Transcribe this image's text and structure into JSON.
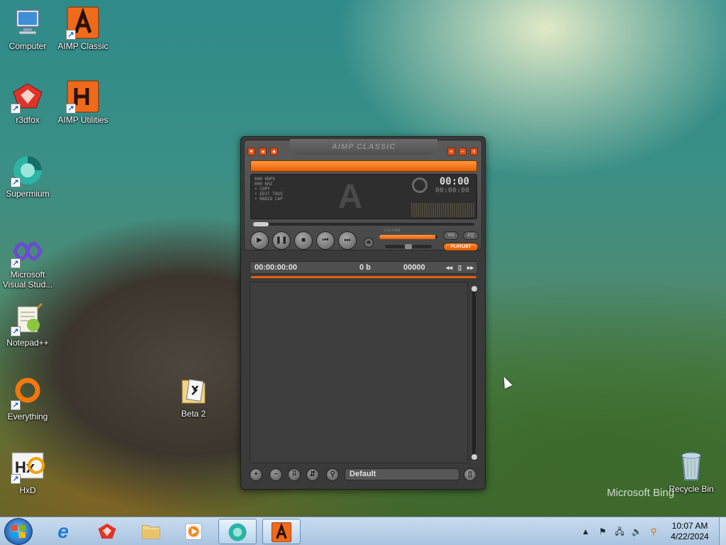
{
  "desktop": {
    "icons": [
      {
        "label": "Computer",
        "glyph": "computer-icon"
      },
      {
        "label": "AIMP Classic",
        "glyph": "aimp-icon"
      },
      {
        "label": "r3dfox",
        "glyph": "r3dfox-icon"
      },
      {
        "label": "AIMP Utilities",
        "glyph": "aimp-utilities-icon"
      },
      {
        "label": "Supermium",
        "glyph": "supermium-icon"
      },
      {
        "label": "Microsoft Visual Stud...",
        "glyph": "visual-studio-icon"
      },
      {
        "label": "Notepad++",
        "glyph": "notepadpp-icon"
      },
      {
        "label": "Everything",
        "glyph": "everything-icon"
      },
      {
        "label": "HxD",
        "glyph": "hxd-icon"
      },
      {
        "label": "Beta 2",
        "glyph": "folder-icon"
      },
      {
        "label": "Recycle Bin",
        "glyph": "recycle-bin-icon"
      }
    ],
    "watermark": "Microsoft Bing"
  },
  "player": {
    "title": "AIMP CLASSIC",
    "info_lines": [
      "000 KBPS",
      "000 KHZ",
      "• COPY",
      "• EDIT TAGS",
      "• RADIO CAP"
    ],
    "time_main": "00:00",
    "time_secondary": "00:00:00",
    "volume_label": "VOLUME",
    "volume_level": 0.96,
    "buttons": {
      "vis": "VIS",
      "eq": "EQ",
      "playlist": "PLAYLIST"
    },
    "playlist": {
      "total_time": "00:00:00:00",
      "size": "0 b",
      "count": "00000",
      "name": "Default"
    }
  },
  "taskbar": {
    "clock_time": "10:07 AM",
    "clock_date": "4/22/2024"
  },
  "colors": {
    "accent": "#e85d06",
    "player_bg": "#3a3a3a",
    "taskbar": "#b9d3ec"
  }
}
